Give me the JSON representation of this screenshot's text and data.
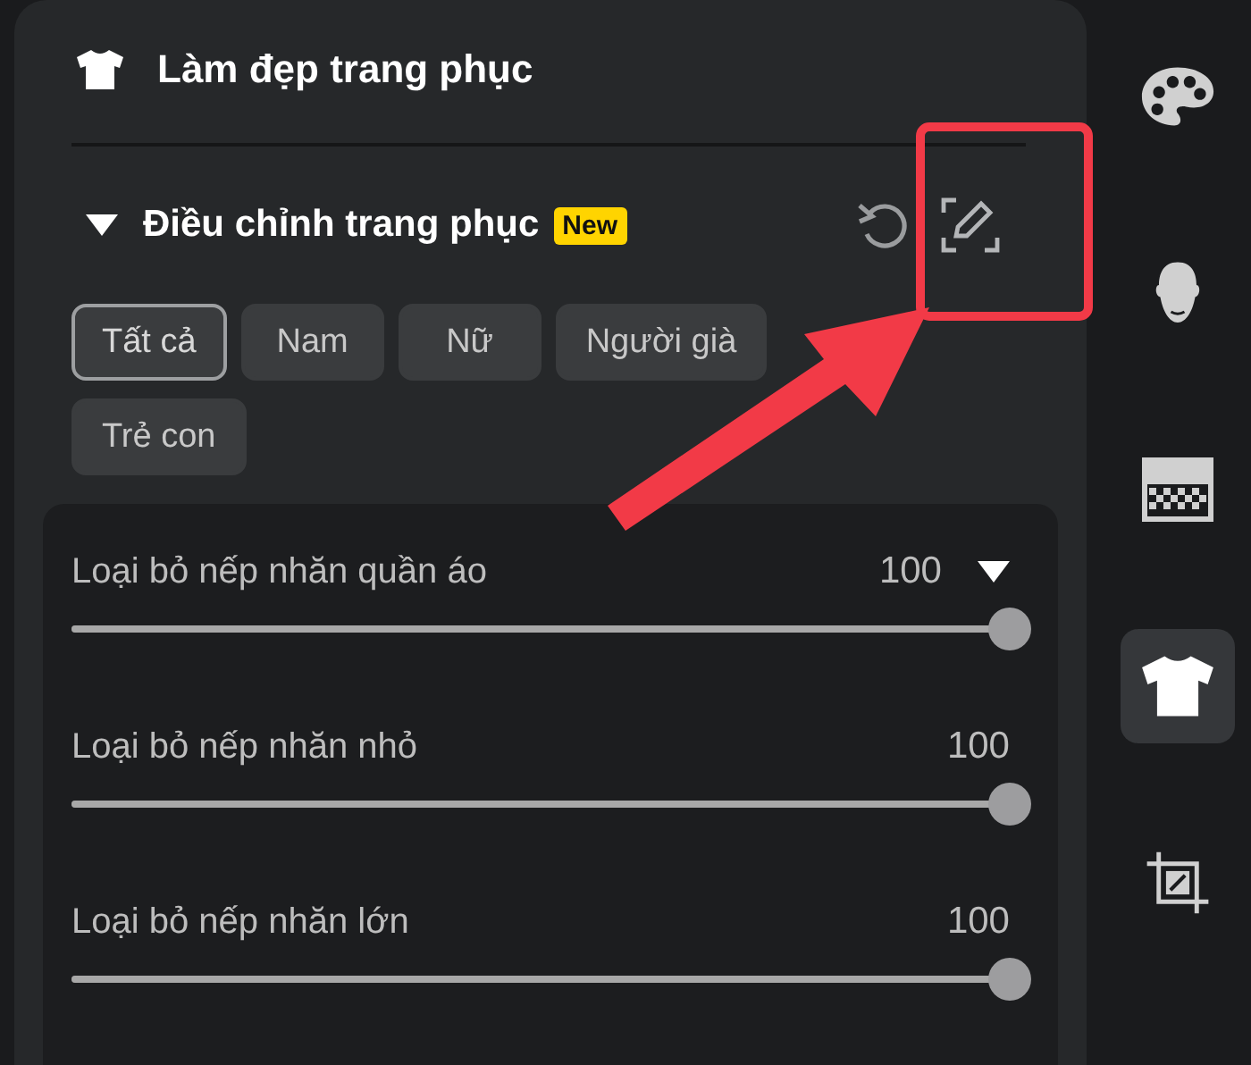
{
  "panel": {
    "title": "Làm đẹp trang phục",
    "section": {
      "title": "Điều chỉnh trang phục",
      "badge": "New",
      "expanded": true
    },
    "chips": [
      {
        "label": "Tất cả",
        "selected": true
      },
      {
        "label": "Nam",
        "selected": false
      },
      {
        "label": "Nữ",
        "selected": false
      },
      {
        "label": "Người già",
        "selected": false
      },
      {
        "label": "Trẻ con",
        "selected": false
      }
    ],
    "sliders": [
      {
        "label": "Loại bỏ nếp nhăn quần áo",
        "value": "100",
        "level": 1,
        "has_menu": true
      },
      {
        "label": "Loại bỏ nếp nhăn nhỏ",
        "value": "100",
        "level": 1,
        "has_menu": false
      },
      {
        "label": "Loại bỏ nếp nhăn lớn",
        "value": "100",
        "level": 1,
        "has_menu": false
      }
    ]
  },
  "sidebar": {
    "items": [
      {
        "kind": "palette",
        "selected": false
      },
      {
        "kind": "head",
        "selected": false
      },
      {
        "kind": "mosaic",
        "selected": false
      },
      {
        "kind": "shirt",
        "selected": true
      },
      {
        "kind": "crop",
        "selected": false
      }
    ]
  }
}
